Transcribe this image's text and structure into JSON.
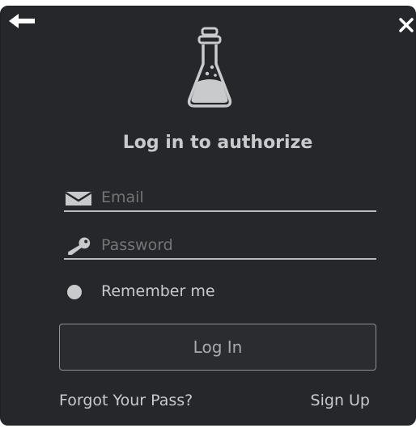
{
  "dialog": {
    "title": "Log in to authorize",
    "icons": {
      "back": "arrow-left-icon",
      "close": "close-icon",
      "logo": "flask-icon",
      "email": "envelope-icon",
      "password": "key-icon",
      "remember": "radio-dot-icon"
    },
    "email": {
      "placeholder": "Email",
      "value": ""
    },
    "password": {
      "placeholder": "Password",
      "value": ""
    },
    "remember_label": "Remember me",
    "login_label": "Log In",
    "forgot_label": "Forgot Your Pass?",
    "signup_label": "Sign Up"
  },
  "colors": {
    "background": "#25272b",
    "text": "#c9cacc",
    "muted_text": "#a9aaac",
    "line": "#b9babc",
    "button_border": "#8e9093"
  }
}
